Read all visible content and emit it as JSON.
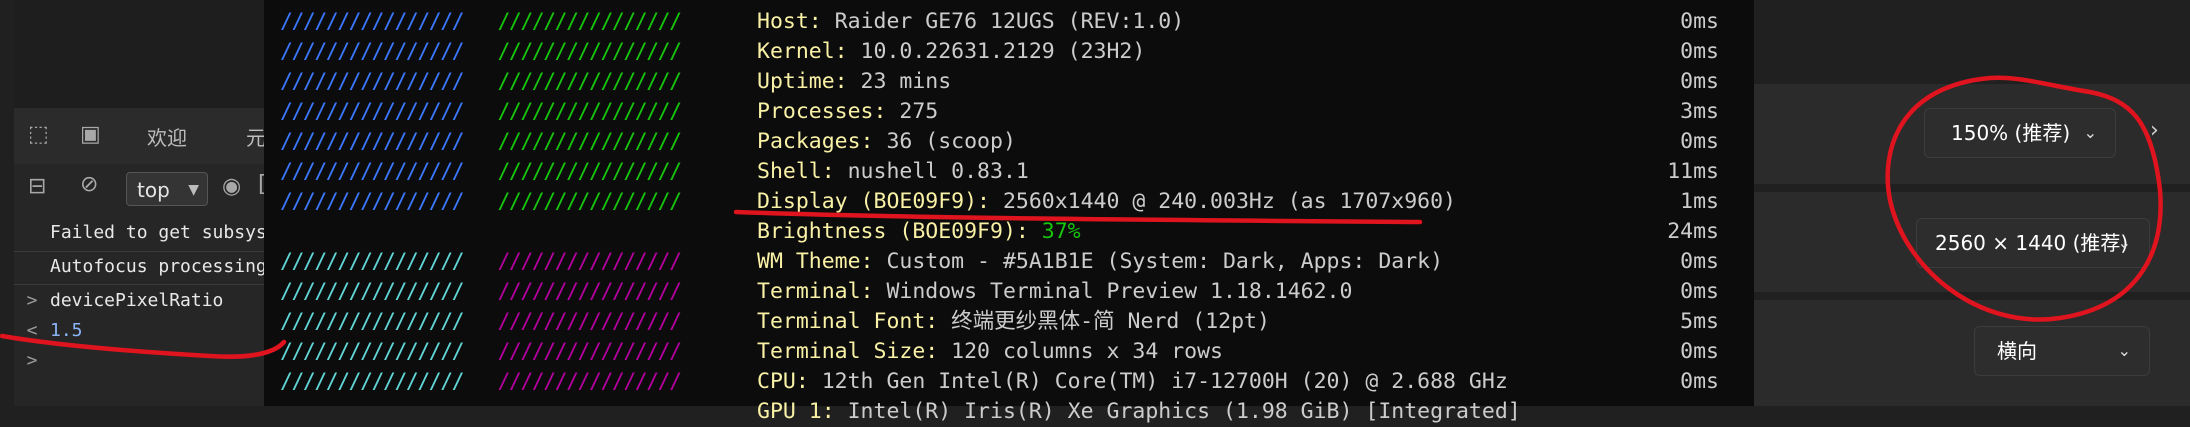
{
  "devtools": {
    "tabs": [
      "欢迎",
      "元"
    ],
    "context_select": "top",
    "console_lines": [
      {
        "kind": "msg",
        "text": "Failed to get subsys"
      },
      {
        "kind": "msg",
        "text": "Autofocus processing"
      },
      {
        "kind": "input",
        "text": "devicePixelRatio"
      },
      {
        "kind": "output",
        "text": "1.5"
      },
      {
        "kind": "prompt",
        "text": ""
      }
    ]
  },
  "terminal": {
    "logo_top": "////////////////   ////////////////",
    "logo_bottom": "////////////////   ////////////////",
    "info": [
      {
        "key": "Host:",
        "value": " Raider GE76 12UGS (REV:1.0)",
        "time": "0ms"
      },
      {
        "key": "Kernel:",
        "value": " 10.0.22631.2129 (23H2)",
        "time": "0ms"
      },
      {
        "key": "Uptime:",
        "value": " 23 mins",
        "time": "0ms"
      },
      {
        "key": "Processes:",
        "value": " 275",
        "time": "3ms"
      },
      {
        "key": "Packages:",
        "value": " 36 (scoop)",
        "time": "0ms"
      },
      {
        "key": "Shell:",
        "value": " nushell 0.83.1",
        "time": "11ms"
      },
      {
        "key": "Display (BOE09F9):",
        "value": " 2560x1440 @ 240.003Hz (as 1707x960)",
        "time": "1ms"
      },
      {
        "key": "Brightness (BOE09F9):",
        "value": " 37%",
        "time": "24ms"
      },
      {
        "key": "WM Theme:",
        "value": " Custom - #5A1B1E (System: Dark, Apps: Dark)",
        "time": "0ms"
      },
      {
        "key": "Terminal:",
        "value": " Windows Terminal Preview 1.18.1462.0",
        "time": "0ms"
      },
      {
        "key": "Terminal Font:",
        "value": " 终端更纱黑体-简 Nerd (12pt)",
        "time": "5ms"
      },
      {
        "key": "Terminal Size:",
        "value": " 120 columns x 34 rows",
        "time": "0ms"
      },
      {
        "key": "CPU:",
        "value": " 12th Gen Intel(R) Core(TM) i7-12700H (20) @ 2.688 GHz",
        "time": "0ms"
      },
      {
        "key": "GPU 1:",
        "value": " Intel(R) Iris(R) Xe Graphics (1.98 GiB) [Integrated]",
        "time": ""
      }
    ]
  },
  "settings": {
    "scale_value": "150% (推荐)",
    "resolution_value": "2560 × 1440 (推荐)",
    "orientation_value": "横向"
  },
  "colors": {
    "terminal_bg": "#0c0c0c",
    "key_yellow": "#f9f1a5",
    "logo_blue": "#3b78ff",
    "logo_green": "#16c60c",
    "logo_cyan": "#61d6d6",
    "logo_magenta": "#b4009e",
    "annotation_red": "#e0141e"
  }
}
